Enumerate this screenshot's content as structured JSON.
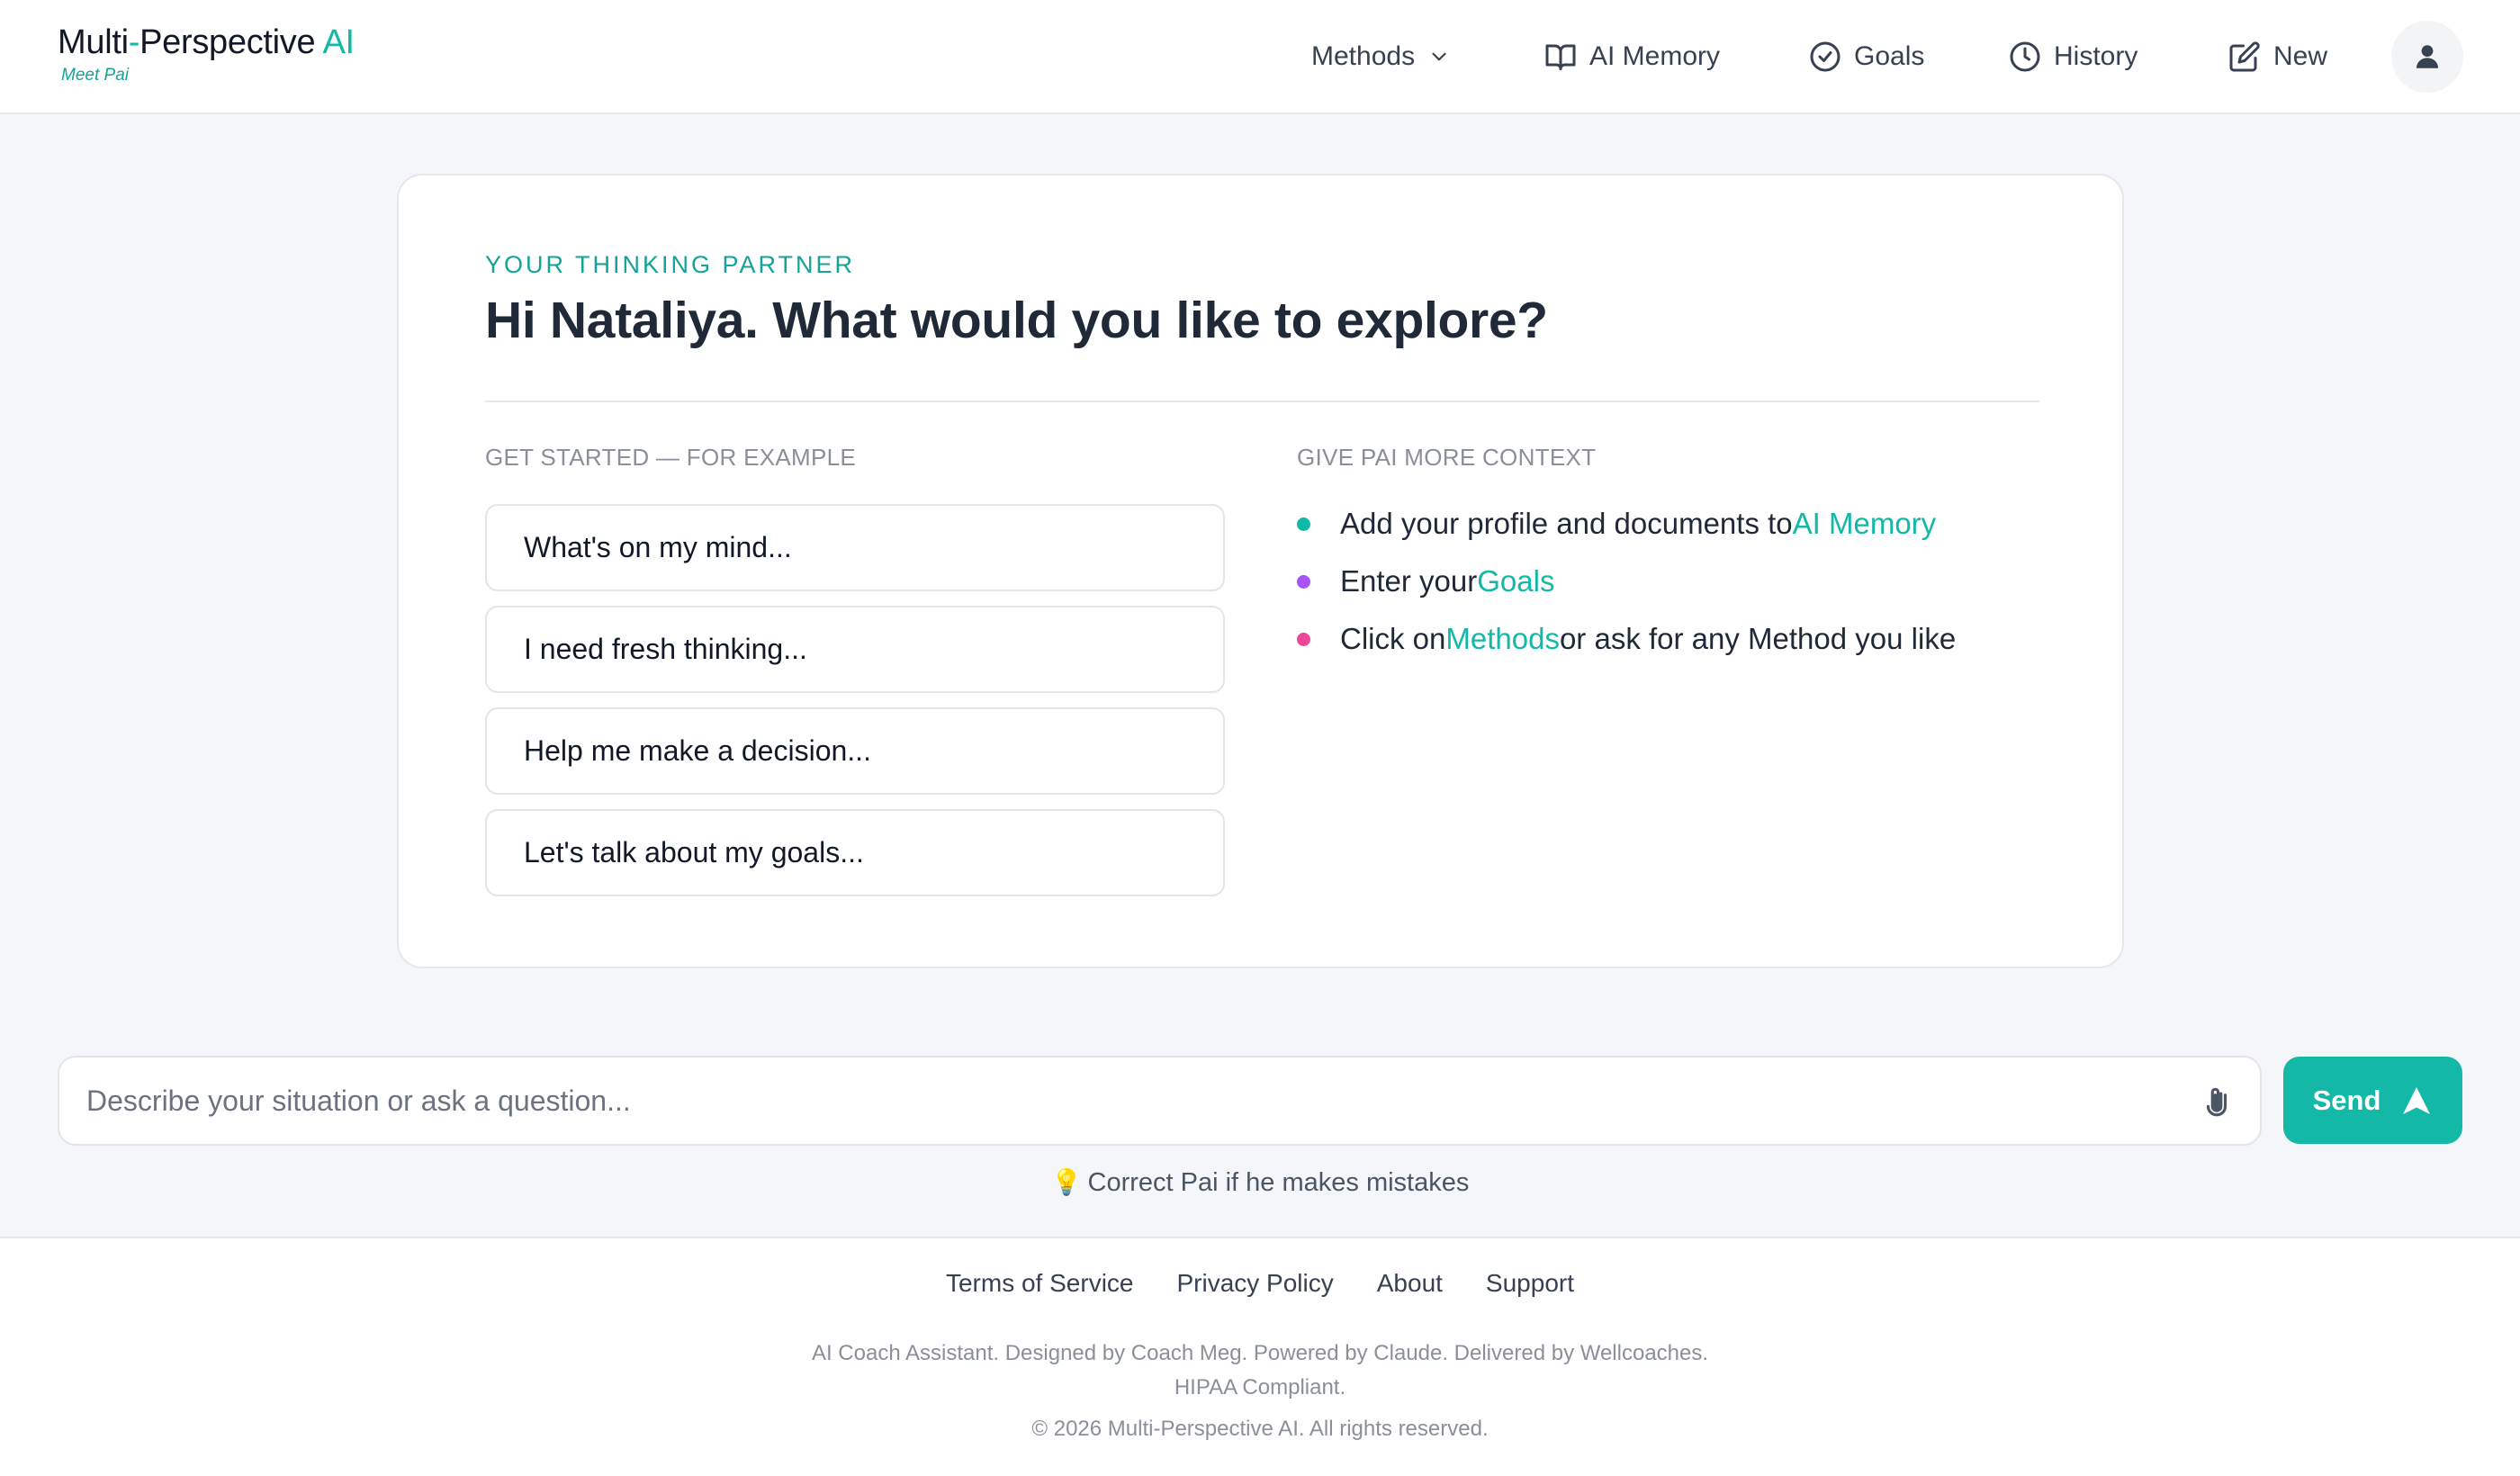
{
  "header": {
    "logo": {
      "part1": "Multi",
      "dash": "-",
      "part2": "Perspective ",
      "ai": "AI",
      "subtitle": "Meet Pai"
    },
    "nav": {
      "methods": "Methods",
      "memory": "AI Memory",
      "goals": "Goals",
      "history": "History",
      "new": "New"
    }
  },
  "card": {
    "eyebrow": "YOUR THINKING PARTNER",
    "headline": "Hi Nataliya. What would you like to explore?",
    "examples_label": "GET STARTED — FOR EXAMPLE",
    "examples": [
      "What's on my mind...",
      "I need fresh thinking...",
      "Help me make a decision...",
      "Let's talk about my goals..."
    ],
    "context_label": "GIVE PAI MORE CONTEXT",
    "context": [
      {
        "before": "Add your profile and documents to ",
        "link": "AI Memory",
        "after": "",
        "color": "#14b8a6"
      },
      {
        "before": "Enter your ",
        "link": "Goals",
        "after": "",
        "color": "#a855f7"
      },
      {
        "before": "Click on ",
        "link": "Methods",
        "after": " or ask for any Method you like",
        "color": "#ec4899"
      }
    ]
  },
  "composer": {
    "placeholder": "Describe your situation or ask a question...",
    "send_label": "Send",
    "hint": "Correct Pai if he makes mistakes"
  },
  "footer": {
    "links": [
      "Terms of Service",
      "Privacy Policy",
      "About",
      "Support"
    ],
    "line1": "AI Coach Assistant. Designed by Coach Meg. Powered by Claude. Delivered by Wellcoaches.",
    "line2": "HIPAA Compliant.",
    "copyright": "© 2026 Multi-Perspective AI. All rights reserved."
  },
  "colors": {
    "accent": "#14b8a6",
    "background": "#f4f6fa"
  }
}
